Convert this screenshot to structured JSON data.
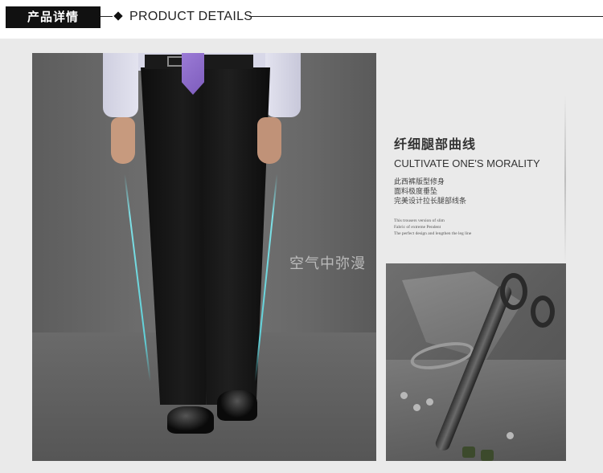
{
  "header": {
    "label": "产品详情",
    "subtitle": "PRODUCT  DETAILS"
  },
  "watermark": "空气中弥漫",
  "text_block": {
    "heading": "纤细腿部曲线",
    "heading_en": "CULTIVATE ONE'S MORALITY",
    "lines_cn": [
      "此西裤版型修身",
      "面料极度垂坠",
      "完美设计拉长腿部线条"
    ],
    "lines_en": [
      "This trousers version of slim",
      "Fabric of extreme Pendent",
      "The perfect design and lengthen the leg line"
    ]
  },
  "colors": {
    "header_bg": "#111111",
    "main_bg": "#eaeaea",
    "guide_line": "#7fe0e6"
  }
}
